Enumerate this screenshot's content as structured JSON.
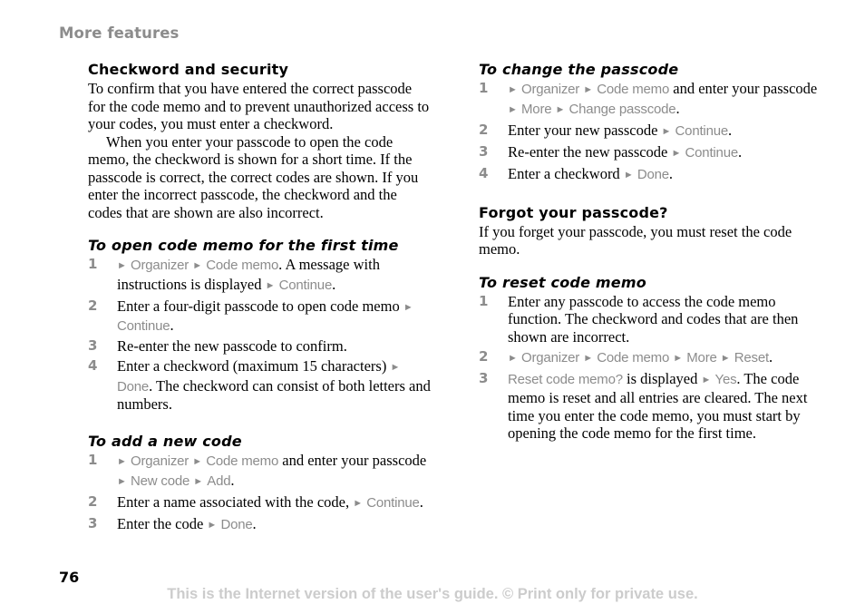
{
  "page": {
    "running_head": "More features",
    "page_number": "76",
    "footer": "This is the Internet version of the user's guide. © Print only for private use."
  },
  "colors": {
    "text": "#000000",
    "ui_gray": "#8c8c8c",
    "footer_gray": "#cccccc"
  },
  "icons": {
    "arrow": "►"
  },
  "left": {
    "security": {
      "heading": "Checkword and security",
      "para1": "To confirm that you have entered the correct passcode for the code memo and to prevent unauthorized access to your codes, you must enter a checkword.",
      "para2": "When you enter your passcode to open the code memo, the checkword is shown for a short time. If the passcode is correct, the correct codes are shown. If you enter the incorrect passcode, the checkword and the codes that are shown are also incorrect."
    },
    "open_first": {
      "heading": "To open code memo for the first time",
      "steps": [
        {
          "num": "1",
          "ui1": "Organizer",
          "ui2": "Code memo",
          "text1": ". A message with instructions is displayed ",
          "ui3": "Continue",
          "end": "."
        },
        {
          "num": "2",
          "text1": "Enter a four-digit passcode to open code memo ",
          "ui1": "Continue",
          "end": "."
        },
        {
          "num": "3",
          "text1": "Re-enter the new passcode to confirm."
        },
        {
          "num": "4",
          "text1": "Enter a checkword (maximum 15 characters) ",
          "ui1": "Done",
          "text2": ". The checkword can consist of both letters and numbers."
        }
      ]
    },
    "add_code": {
      "heading": "To add a new code",
      "steps": [
        {
          "num": "1",
          "ui1": "Organizer",
          "ui2": "Code memo",
          "text1": " and enter your passcode ",
          "ui3": "New code",
          "ui4": "Add",
          "end": "."
        },
        {
          "num": "2",
          "text1": "Enter a name associated with the code, ",
          "ui1": "Continue",
          "end": "."
        },
        {
          "num": "3",
          "text1": "Enter the code ",
          "ui1": "Done",
          "end": "."
        }
      ]
    }
  },
  "right": {
    "change_passcode": {
      "heading": "To change the passcode",
      "steps": [
        {
          "num": "1",
          "ui1": "Organizer",
          "ui2": "Code memo",
          "text1": " and enter your passcode ",
          "ui3": "More",
          "ui4": "Change passcode",
          "end": "."
        },
        {
          "num": "2",
          "text1": "Enter your new passcode ",
          "ui1": "Continue",
          "end": "."
        },
        {
          "num": "3",
          "text1": "Re-enter the new passcode ",
          "ui1": "Continue",
          "end": "."
        },
        {
          "num": "4",
          "text1": "Enter a checkword ",
          "ui1": "Done",
          "end": "."
        }
      ]
    },
    "forgot": {
      "heading": "Forgot your passcode?",
      "para": "If you forget your passcode, you must reset the code memo."
    },
    "reset": {
      "heading": "To reset code memo",
      "steps": [
        {
          "num": "1",
          "text1": "Enter any passcode to access the code memo function. The checkword and codes that are then shown are incorrect."
        },
        {
          "num": "2",
          "ui1": "Organizer",
          "ui2": "Code memo",
          "ui3": "More",
          "ui4": "Reset",
          "end": "."
        },
        {
          "num": "3",
          "ui1": "Reset code memo?",
          "text1": " is displayed ",
          "ui2": "Yes",
          "text2": ". The code memo is reset and all entries are cleared. The next time you enter the code memo, you must start by opening the code memo for the first time."
        }
      ]
    }
  }
}
